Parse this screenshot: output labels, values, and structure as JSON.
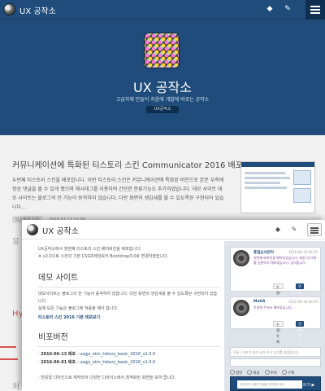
{
  "back_header": {
    "title": "UX 공작소"
  },
  "hero": {
    "title": "UX 공작소",
    "subtitle": "고급자체 만들어 처음에 개발에 바로는 공작소",
    "badge": "UX공작소"
  },
  "post": {
    "title": "커뮤니케이션에 특화된 티스토리 스킨 Communicator 2016 배포",
    "body": "두번째 티스토리 스킨을 배포합니다. 이번 티스토리 스킨은 커뮤니케이션에 특화된 버전으로 본문 우측에 항상 댓글을 볼 수 있게 했으며 해시태그를 이용하여 간단한 분류기능도 추가하였습니다. 데모 사이트 데모 사이트는 블로그의 전 기능이 동작하지 않습니다. 다만 화면의 생김새를 볼 수 있도록된 구현되어 있습니다...",
    "tag": "티스토리 스킨",
    "date": "2016.07.17 22:06"
  },
  "back_fragments": {
    "left1": "유",
    "left2": "Hy",
    "left3": "처"
  },
  "front_header": {
    "title": "UX 공작소"
  },
  "main": {
    "intro1": "UX공작소에서 첫번째 티스토리 스킨 배터버전을 배포합니다.",
    "intro2": "※ v2.0으로 스킨의 기본 CSS프레임워크 Bootstrap3.0로 변경하였습니다.",
    "demo_heading": "데모 사이트",
    "demo_text1": "데모사이트는 블로그의 전 기능이 동작하지 않습니다. 다만 화면의 생김새를 볼 수 있도록된 구현되어 있습니다.",
    "demo_text2": "실제 모든 기능은 블로그에 적용을 해야 합니다.",
    "demo_link": "티스토리 스킨 2016 기본 데모보기",
    "dist_heading": "비포버전",
    "dist_items": [
      {
        "date": "2016-06-13 배포",
        "name": "uxgjs_skin_tistory_basic_2016_v2.0.0"
      },
      {
        "date": "2016-06-01 배포",
        "name": "uxgjs_skin_tistory_basic_2016_v1.0.0"
      }
    ],
    "footer_note": "· 반응형 디자인으로 제작되어 다양한 디바이스에서 최적화된 화면을 보여 줍니다."
  },
  "comments": [
    {
      "name": "홍길순사연러",
      "date": "2016.06.14 00:25",
      "text": "첫번째 배포본을 예약되었습니다. 제한 대 마워를 일변하지 해보였습니다. 감사합니다",
      "btn_reply": "수정/삭제",
      "btn_comment": "댓글쓰기"
    },
    {
      "name": "MeGS",
      "date": "2016.06.16 00:25",
      "text": "안내해 주셔서 해보았습니다.",
      "btn_reply": "수정/삭제",
      "btn_comment": "댓글쓰기"
    }
  ],
  "comment_form": {
    "name_placeholder": "댓글 | 기본기 원하 남아 주시 답기를 설정합니다",
    "options": [
      "일반",
      "비공",
      "수다",
      "구략"
    ],
    "textarea_placeholder": "여러분의 소중한 댓글을 입력해주세요",
    "submit": "쓰기 ▶"
  }
}
